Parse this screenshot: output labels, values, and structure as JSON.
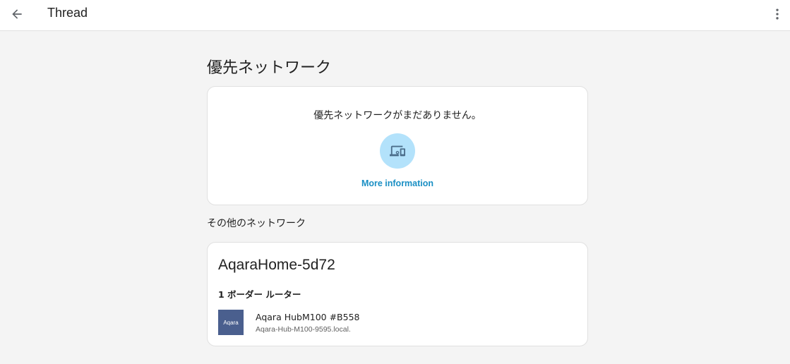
{
  "header": {
    "back_icon": "arrow-left-icon",
    "title": "Thread",
    "menu_icon": "more-vertical-icon"
  },
  "preferred": {
    "section_title": "優先ネットワーク",
    "empty_text": "優先ネットワークがまだありません。",
    "icon": "devices-icon",
    "icon_bg_color": "#b3e2fb",
    "more_info_label": "More information",
    "link_color": "#1a8fc4"
  },
  "other": {
    "section_title": "その他のネットワーク",
    "networks": [
      {
        "name": "AqaraHome-5d72",
        "router_count": "1 ボーダー ルーター",
        "routers": [
          {
            "logo_text": "Aqara",
            "name": "Aqara HubM100 #B558",
            "host": "Aqara-Hub-M100-9595.local."
          }
        ]
      }
    ]
  }
}
